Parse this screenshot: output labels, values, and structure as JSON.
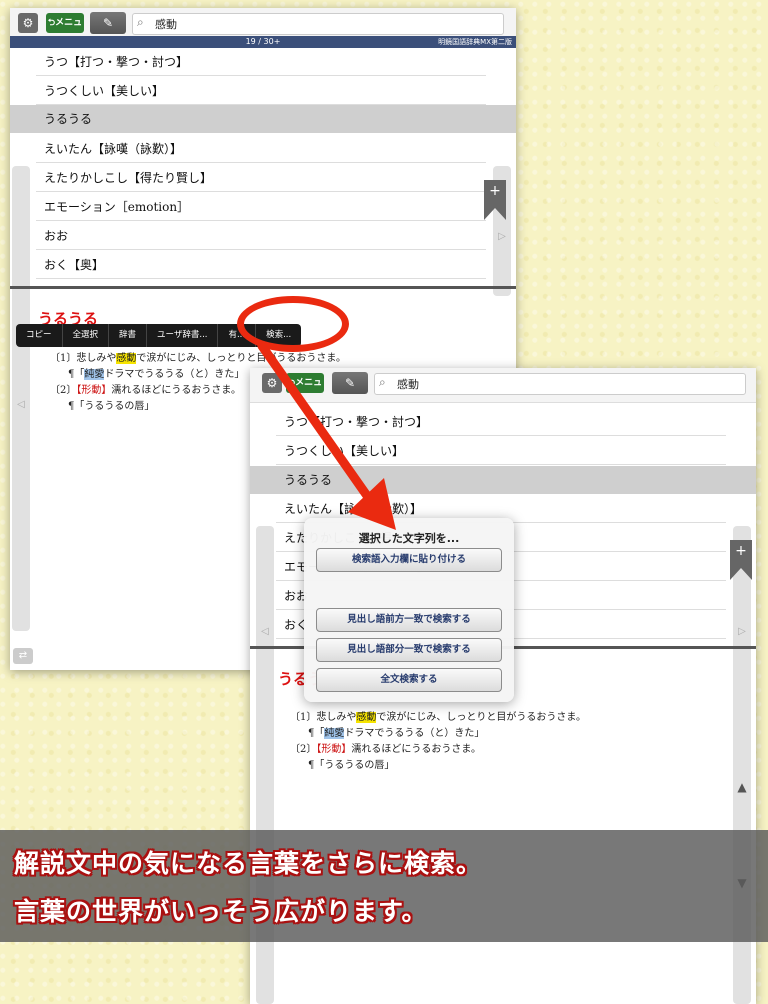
{
  "toolbar": {
    "gear": "⚙",
    "menu_label": "⮌メニュー",
    "pen": "✎",
    "search_icon": "🔍",
    "search_query": "感動"
  },
  "status": {
    "page": "19 / 30+",
    "source": "明鏡国語辞典MX第二版"
  },
  "list": [
    {
      "label": "うつ【打つ・撃つ・討つ】",
      "selected": false
    },
    {
      "label": "うつくしい【美しい】",
      "selected": false
    },
    {
      "label": "うるうる",
      "selected": true
    },
    {
      "label": "えいたん【詠嘆（詠歎）】",
      "selected": false
    },
    {
      "label": "えたりかしこし【得たり賢し】",
      "selected": false
    },
    {
      "label": "エモーション［emotion］",
      "selected": false
    },
    {
      "label": "おお",
      "selected": false
    },
    {
      "label": "おく【奥】",
      "selected": false
    }
  ],
  "entry": {
    "title": "うるうる",
    "sense1_num": "〔1〕",
    "sense1_a": "悲",
    "sense1_b": "しみや",
    "sense1_hl": "感動",
    "sense1_c": "で涙がにじみ、しっとりと目がうるおうさま。",
    "ex1_mark": "¶「",
    "ex1_sel": "純愛",
    "ex1_rest": "ドラマでうるうる（と）きた」",
    "sense2_num": "〔2〕",
    "sense2_pos": "【形動】",
    "sense2_text": "濡れるほどにうるおうさま。",
    "ex2": "¶「うるうるの唇」"
  },
  "context_menu": [
    "コピー",
    "全選択",
    "辞書",
    "ユーザ辞書...",
    "有...",
    "検索..."
  ],
  "popup": {
    "title": "選択した文字列を...",
    "buttons": [
      "検索語入力欄に貼り付ける",
      "見出し語前方一致で検索する",
      "見出し語部分一致で検索する",
      "全文検索する"
    ]
  },
  "caption": {
    "line1": "解説文中の気になる言葉をさらに検索。",
    "line2": "言葉の世界がいっそう広がります。"
  },
  "colors": {
    "accent_red": "#d11111",
    "status_blue": "#3b4f7a",
    "menu_green": "#2e7d32",
    "highlight": "#f6e400"
  }
}
